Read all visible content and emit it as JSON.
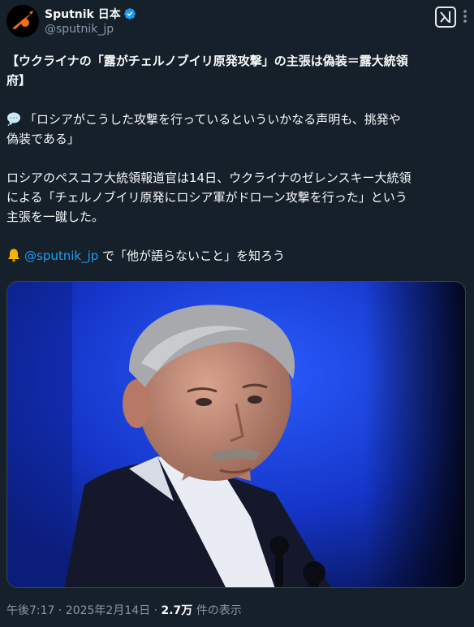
{
  "author": {
    "display_name": "Sputnik 日本",
    "handle": "@sputnik_jp",
    "verified": true
  },
  "tweet": {
    "line1": "【ウクライナの「露がチェルノブイリ原発攻撃」の主張は偽装＝露大統領",
    "line2": "府】",
    "quote_line1": "「ロシアがこうした攻撃を行っているといういかなる声明も、挑発や",
    "quote_line2": "偽装である」",
    "body_line1": "ロシアのペスコフ大統領報道官は14日、ウクライナのゼレンスキー大統領",
    "body_line2": "による「チェルノブイリ原発にロシア軍がドローン攻撃を行った」という",
    "body_line3": "主張を一蹴した。",
    "cta_mention": "@sputnik_jp",
    "cta_text": " で「他が語らないこと」を知ろう"
  },
  "meta": {
    "time": "午後7:17 · 2025年2月14日 · ",
    "views_count": "2.7万",
    "views_label": " 件の表示"
  },
  "icons": {
    "avatar": "sputnik-logo-icon",
    "verified": "verified-badge-icon",
    "grok": "grok-icon",
    "more": "more-icon",
    "speech": "speech-bubble-icon",
    "bell": "bell-icon"
  },
  "colors": {
    "background": "#15202b",
    "link": "#1d9bf0",
    "verified": "#1d9bf0",
    "secondary_text": "#8b98a5",
    "logo_orange": "#f46e1a"
  }
}
